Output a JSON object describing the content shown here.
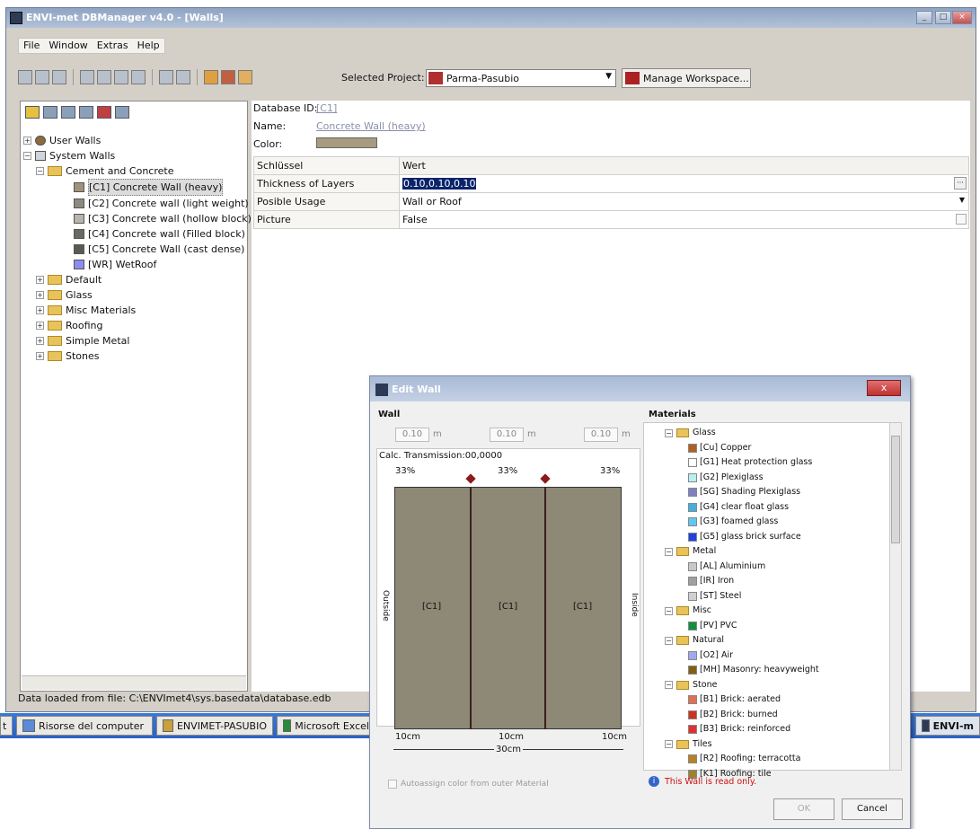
{
  "main_window": {
    "title": "ENVI-met DBManager v4.0 - [Walls]",
    "menu": [
      "File",
      "Window",
      "Extras",
      "Help"
    ],
    "selected_project_label": "Selected Project:",
    "selected_project_value": "Parma-Pasubio",
    "manage_workspace_label": "Manage Workspace...",
    "tree": {
      "user_walls": "User Walls",
      "system_walls": "System Walls",
      "cement_and_concrete": "Cement and Concrete",
      "items": [
        {
          "label": "[C1] Concrete Wall (heavy)",
          "color": "#a0927a",
          "selected": true
        },
        {
          "label": "[C2] Concrete wall (light weight)",
          "color": "#8e8a80",
          "selected": false
        },
        {
          "label": "[C3] Concrete wall (hollow block)",
          "color": "#b8b4ac",
          "selected": false
        },
        {
          "label": "[C4] Concrete wall (Filled block)",
          "color": "#6a6860",
          "selected": false
        },
        {
          "label": "[C5] Concrete Wall (cast dense)",
          "color": "#585c50",
          "selected": false
        },
        {
          "label": "[WR] WetRoof",
          "color": "#8c8cf0",
          "selected": false
        }
      ],
      "other_folders": [
        "Default",
        "Glass",
        "Misc Materials",
        "Roofing",
        "Simple Metal",
        "Stones"
      ]
    },
    "properties": {
      "database_id_label": "Database ID:",
      "database_id_value": "[C1]",
      "name_label": "Name:",
      "name_value": "Concrete Wall (heavy)",
      "color_label": "Color:",
      "color_value": "#a89a80",
      "header_key": "Schlüssel",
      "header_value": "Wert",
      "rows": [
        {
          "key": "Thickness of Layers",
          "value": "0.10,0.10,0.10"
        },
        {
          "key": "Posible Usage",
          "value": "Wall or Roof"
        },
        {
          "key": "Picture",
          "value": "False"
        }
      ]
    },
    "status": "Data loaded from file: C:\\ENVImet4\\sys.basedata\\database.edb"
  },
  "taskbar": {
    "items": [
      "t",
      "Risorse del computer",
      "ENVIMET-PASUBIO",
      "Microsoft Excel"
    ],
    "right_item": "ENVI-m"
  },
  "dialog": {
    "title": "Edit Wall",
    "close_label": "x",
    "wall_section": "Wall",
    "materials_section": "Materials",
    "thickness_fields": [
      "0.10",
      "0.10",
      "0.10"
    ],
    "unit": "m",
    "calc_transmission": "Calc. Transmission:00,0000",
    "percentages": [
      "33%",
      "33%",
      "33%"
    ],
    "layer_labels": [
      "[C1]",
      "[C1]",
      "[C1]"
    ],
    "outside_label": "Outside",
    "inside_label": "Inside",
    "bottom_cm": [
      "10cm",
      "10cm",
      "10cm"
    ],
    "total_cm": "30cm",
    "autoassign_label": "Autoassign color from outer Material",
    "materials": [
      {
        "type": "folder",
        "label": "Glass"
      },
      {
        "type": "item",
        "label": "[Cu] Copper",
        "color": "#b06020"
      },
      {
        "type": "item",
        "label": "[G1] Heat protection glass",
        "color": "#ffffff"
      },
      {
        "type": "item",
        "label": "[G2] Plexiglass",
        "color": "#b8f0f0"
      },
      {
        "type": "item",
        "label": "[SG] Shading Plexiglass",
        "color": "#8080c0"
      },
      {
        "type": "item",
        "label": "[G4] clear float glass",
        "color": "#40b0e0"
      },
      {
        "type": "item",
        "label": "[G3] foamed glass",
        "color": "#60c8f0"
      },
      {
        "type": "item",
        "label": "[G5] glass brick surface",
        "color": "#2040e0"
      },
      {
        "type": "folder",
        "label": "Metal"
      },
      {
        "type": "item",
        "label": "[AL] Aluminium",
        "color": "#c8c8c8"
      },
      {
        "type": "item",
        "label": "[IR] Iron",
        "color": "#a0a0a0"
      },
      {
        "type": "item",
        "label": "[ST] Steel",
        "color": "#d0d0d0"
      },
      {
        "type": "folder",
        "label": "Misc"
      },
      {
        "type": "item",
        "label": "[PV] PVC",
        "color": "#109040"
      },
      {
        "type": "folder",
        "label": "Natural"
      },
      {
        "type": "item",
        "label": "[O2] Air",
        "color": "#a0a8f0"
      },
      {
        "type": "item",
        "label": "[MH] Masonry: heavyweight",
        "color": "#806010"
      },
      {
        "type": "folder",
        "label": "Stone"
      },
      {
        "type": "item",
        "label": "[B1] Brick: aerated",
        "color": "#e07050"
      },
      {
        "type": "item",
        "label": "[B2] Brick: burned",
        "color": "#d03020"
      },
      {
        "type": "item",
        "label": "[B3] Brick: reinforced",
        "color": "#e03030"
      },
      {
        "type": "folder",
        "label": "Tiles"
      },
      {
        "type": "item",
        "label": "[R2] Roofing: terracotta",
        "color": "#b88020"
      },
      {
        "type": "item",
        "label": "[K1] Roofing: tile",
        "color": "#a08030"
      }
    ],
    "info_text": "This Wall is read only.",
    "ok_label": "OK",
    "cancel_label": "Cancel"
  }
}
